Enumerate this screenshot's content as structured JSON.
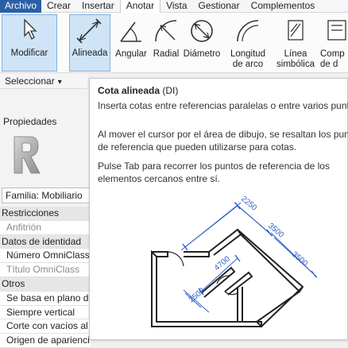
{
  "menu_tabs": [
    "Archivo",
    "Crear",
    "Insertar",
    "Anotar",
    "Vista",
    "Gestionar",
    "Complementos"
  ],
  "active_tab": "Anotar",
  "ribbon": {
    "buttons": [
      {
        "name": "modificar-button",
        "label": "Modificar",
        "icon": "cursor-arrow-icon"
      },
      {
        "name": "alineada-button",
        "label": "Alineada",
        "icon": "aligned-dimension-icon"
      },
      {
        "name": "angular-button",
        "label": "Angular",
        "icon": "angular-dimension-icon"
      },
      {
        "name": "radial-button",
        "label": "Radial",
        "icon": "radial-dimension-icon"
      },
      {
        "name": "diametro-button",
        "label": "Diámetro",
        "icon": "diameter-dimension-icon"
      },
      {
        "name": "longitud-arco-button",
        "label_line1": "Longitud",
        "label_line2": "de arco",
        "icon": "arc-length-icon"
      },
      {
        "name": "linea-simbolica-button",
        "label_line1": "Línea",
        "label_line2": "simbólica",
        "icon": "symbolic-line-icon"
      },
      {
        "name": "componente-button",
        "label_line1": "Comp",
        "label_line2": "de d",
        "icon": "component-icon"
      }
    ],
    "panel_label": "Seleccionar"
  },
  "properties": {
    "title": "Propiedades",
    "family": "Familia: Mobiliario",
    "rows": [
      {
        "text": "Restricciones",
        "kind": "head"
      },
      {
        "text": "Anfitrión",
        "kind": "dim"
      },
      {
        "text": "Datos de identidad",
        "kind": "head"
      },
      {
        "text": "Número OmniClass",
        "kind": "item"
      },
      {
        "text": "Título OmniClass",
        "kind": "dim"
      },
      {
        "text": "Otros",
        "kind": "head"
      },
      {
        "text": "Se basa en plano de",
        "kind": "item"
      },
      {
        "text": "Siempre vertical",
        "kind": "item"
      },
      {
        "text": "Corte con vacíos al c",
        "kind": "item"
      },
      {
        "text": "Origen de aparienci",
        "kind": "item"
      }
    ]
  },
  "tooltip": {
    "title": "Cota alineada",
    "shortcut": "(DI)",
    "desc": "Inserta cotas entre referencias paralelas o entre varios puntos",
    "p2_line1": "Al mover el cursor por el área de dibujo, se resaltan los punt",
    "p2_line2": "de referencia que pueden utilizarse para cotas.",
    "p3_line1": "Pulse Tab para recorrer los puntos de referencia de los",
    "p3_line2": "elementos cercanos entre sí.",
    "dimensions": [
      "2250",
      "3500",
      "3500",
      "4700",
      "2500"
    ]
  },
  "colors": {
    "file_tab": "#2a5fa8",
    "selected": "#cfe4f7",
    "dimension_line": "#2f5fc9"
  }
}
